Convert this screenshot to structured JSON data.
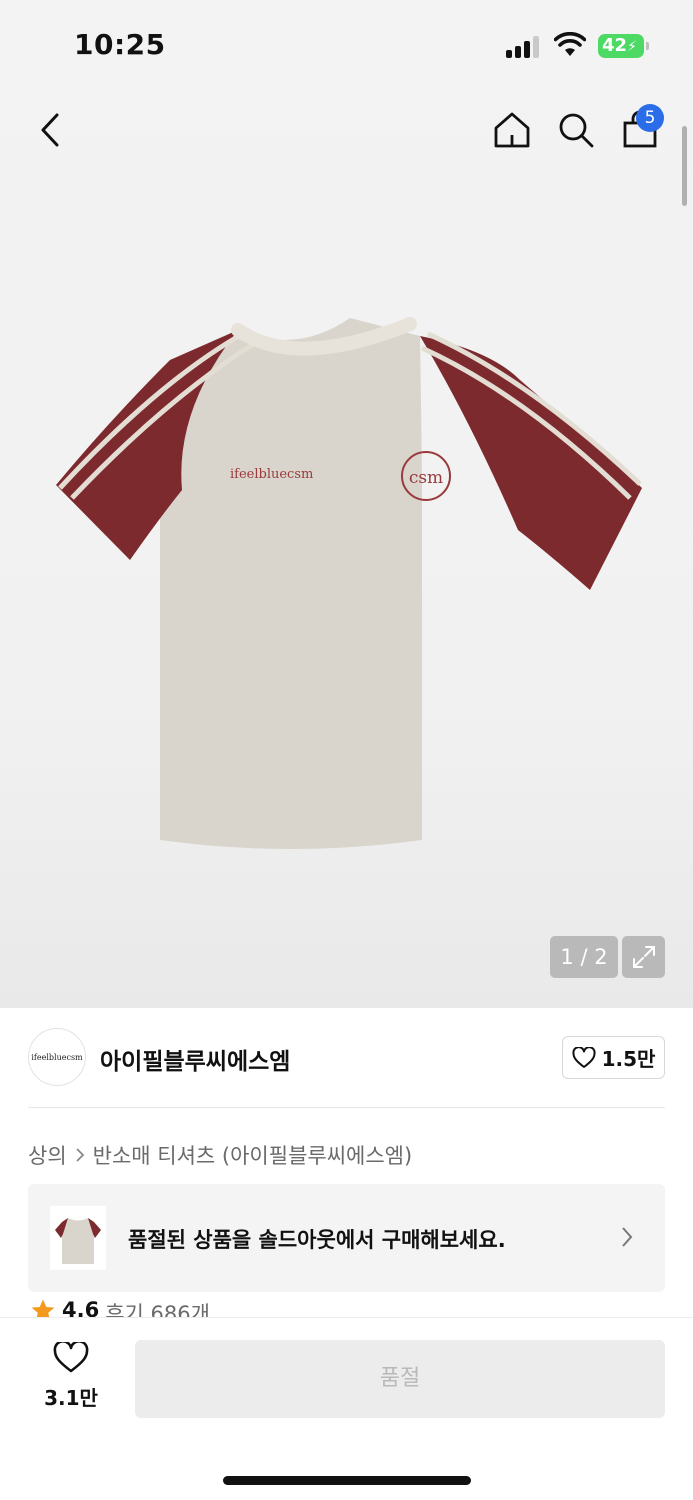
{
  "status_bar": {
    "time": "10:25",
    "battery": "42"
  },
  "header": {
    "back_icon": "chevron-left-icon",
    "home_icon": "home-icon",
    "search_icon": "search-icon",
    "cart_icon": "shopping-bag-icon",
    "cart_count": "5"
  },
  "gallery": {
    "pager": "1 / 2",
    "expand_icon": "expand-icon",
    "image": {
      "body_color": "#d9d4cc",
      "sleeve_color": "#7d2a2e",
      "print_text": "ifeelbluecsm",
      "logo_text": "csm"
    }
  },
  "brand": {
    "logo_text": "ifeelbluecsm",
    "name": "아이필블루씨에스엠",
    "likes": "1.5만"
  },
  "breadcrumb": {
    "items": [
      "상의",
      "반소매 티셔츠 (아이필블루씨에스엠)"
    ]
  },
  "soldout_banner": {
    "text": "품절된 상품을 솔드아웃에서 구매해보세요."
  },
  "rating": {
    "score": "4.6",
    "reviews": "후기 686개"
  },
  "bottom_bar": {
    "wish_count": "3.1만",
    "buy_label": "품절"
  },
  "colors": {
    "accent_blue": "#2b6de8",
    "star": "#f39a1e",
    "battery": "#4cd964"
  }
}
